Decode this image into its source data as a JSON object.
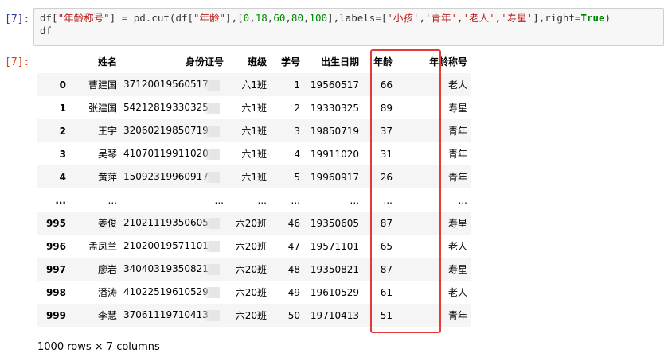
{
  "cell_input": {
    "prompt": "[7]:",
    "code_lines": [
      [
        {
          "t": "df[",
          "c": ""
        },
        {
          "t": "\"年龄称号\"",
          "c": "s"
        },
        {
          "t": "] ",
          "c": ""
        },
        {
          "t": "=",
          "c": "o"
        },
        {
          "t": " pd.cut(df[",
          "c": ""
        },
        {
          "t": "\"年龄\"",
          "c": "s"
        },
        {
          "t": "],[",
          "c": ""
        },
        {
          "t": "0",
          "c": "n"
        },
        {
          "t": ",",
          "c": ""
        },
        {
          "t": "18",
          "c": "n"
        },
        {
          "t": ",",
          "c": ""
        },
        {
          "t": "60",
          "c": "n"
        },
        {
          "t": ",",
          "c": ""
        },
        {
          "t": "80",
          "c": "n"
        },
        {
          "t": ",",
          "c": ""
        },
        {
          "t": "100",
          "c": "n"
        },
        {
          "t": "],labels",
          "c": ""
        },
        {
          "t": "=",
          "c": "o"
        },
        {
          "t": "[",
          "c": ""
        },
        {
          "t": "'小孩'",
          "c": "s"
        },
        {
          "t": ",",
          "c": ""
        },
        {
          "t": "'青年'",
          "c": "s"
        },
        {
          "t": ",",
          "c": ""
        },
        {
          "t": "'老人'",
          "c": "s"
        },
        {
          "t": ",",
          "c": ""
        },
        {
          "t": "'寿星'",
          "c": "s"
        },
        {
          "t": "],right",
          "c": ""
        },
        {
          "t": "=",
          "c": "o"
        },
        {
          "t": "True",
          "c": "k"
        },
        {
          "t": ")",
          "c": ""
        }
      ],
      [
        {
          "t": "df",
          "c": ""
        }
      ]
    ]
  },
  "cell_output": {
    "prompt": "[7]:",
    "columns": [
      "",
      "姓名",
      "身份证号",
      "班级",
      "学号",
      "出生日期",
      "年龄",
      "年龄称号"
    ],
    "rows": [
      [
        "0",
        "曹建国",
        "37120019560517",
        "六1班",
        "1",
        "19560517",
        "66",
        "老人"
      ],
      [
        "1",
        "张建国",
        "54212819330325",
        "六1班",
        "2",
        "19330325",
        "89",
        "寿星"
      ],
      [
        "2",
        "王宇",
        "32060219850719",
        "六1班",
        "3",
        "19850719",
        "37",
        "青年"
      ],
      [
        "3",
        "吴琴",
        "41070119911020",
        "六1班",
        "4",
        "19911020",
        "31",
        "青年"
      ],
      [
        "4",
        "黄萍",
        "15092319960917",
        "六1班",
        "5",
        "19960917",
        "26",
        "青年"
      ],
      [
        "...",
        "...",
        "...",
        "...",
        "...",
        "...",
        "...",
        "..."
      ],
      [
        "995",
        "姜俊",
        "21021119350605",
        "六20班",
        "46",
        "19350605",
        "87",
        "寿星"
      ],
      [
        "996",
        "孟凤兰",
        "21020019571101",
        "六20班",
        "47",
        "19571101",
        "65",
        "老人"
      ],
      [
        "997",
        "廖岩",
        "34040319350821",
        "六20班",
        "48",
        "19350821",
        "87",
        "寿星"
      ],
      [
        "998",
        "潘涛",
        "41022519610529",
        "六20班",
        "49",
        "19610529",
        "61",
        "老人"
      ],
      [
        "999",
        "李慧",
        "37061119710413",
        "六20班",
        "50",
        "19710413",
        "51",
        "青年"
      ]
    ],
    "shape_text": "1000 rows × 7 columns"
  },
  "colors": {
    "input_prompt": "#303f9f",
    "output_prompt": "#d84315",
    "highlight_border": "#e53935"
  }
}
